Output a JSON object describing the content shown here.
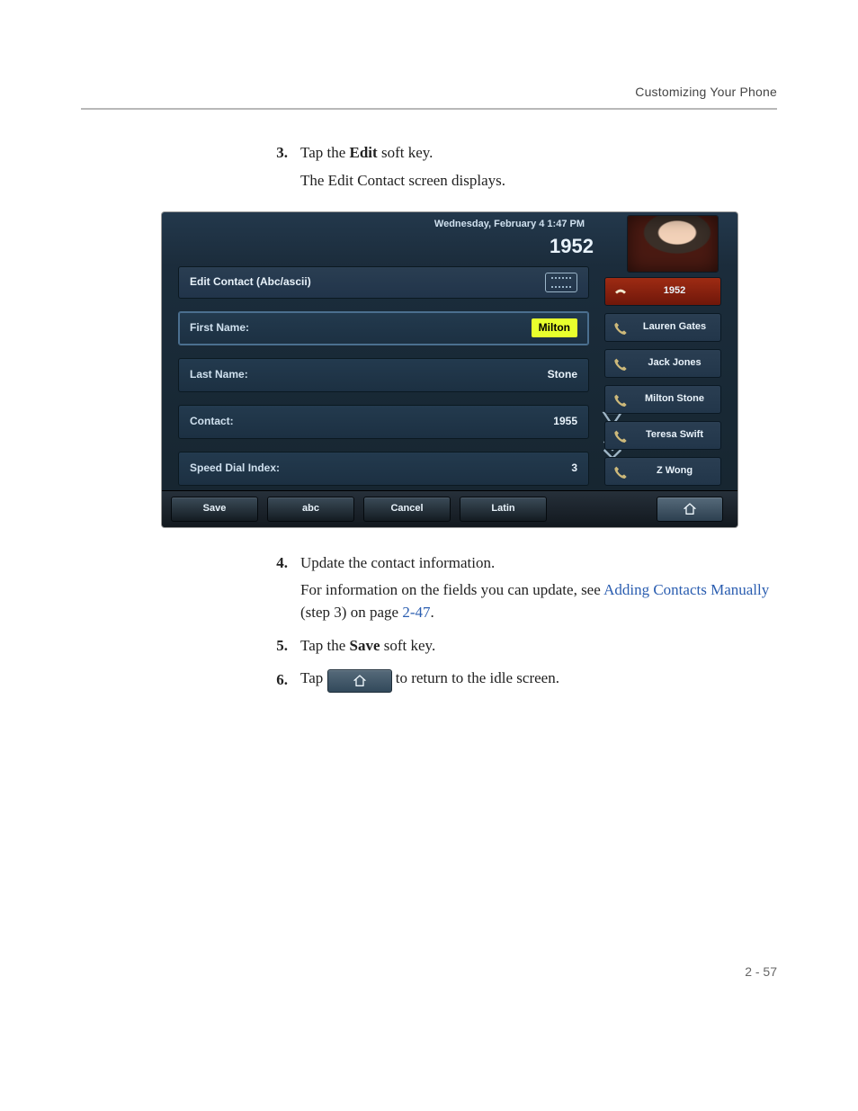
{
  "header": {
    "running_head": "Customizing Your Phone"
  },
  "steps": {
    "s3_num": "3.",
    "s3_text_a": "Tap the ",
    "s3_bold": "Edit",
    "s3_text_b": " soft key.",
    "s3_sub": "The Edit Contact screen displays.",
    "s4_num": "4.",
    "s4_text": "Update the contact information.",
    "s4_sub_a": "For information on the fields you can update, see ",
    "s4_link": "Adding Contacts Manually",
    "s4_sub_b": " (step 3) on page ",
    "s4_pageref": "2-47",
    "s4_sub_c": ".",
    "s5_num": "5.",
    "s5_text_a": "Tap the ",
    "s5_bold": "Save",
    "s5_text_b": " soft key.",
    "s6_num": "6.",
    "s6_text_a": "Tap ",
    "s6_text_b": " to return to the idle screen."
  },
  "footer": {
    "page_number": "2 - 57"
  },
  "screenshot": {
    "date": "Wednesday, February 4  1:47 PM",
    "extension": "1952",
    "panel_title": "Edit Contact (Abc/ascii)",
    "fields": {
      "first_name": {
        "label": "First Name:",
        "value": "Milton"
      },
      "last_name": {
        "label": "Last Name:",
        "value": "Stone"
      },
      "contact": {
        "label": "Contact:",
        "value": "1955"
      },
      "speed_dial": {
        "label": "Speed Dial Index:",
        "value": "3"
      }
    },
    "sidebar": {
      "items": [
        {
          "label": "1952",
          "icon": "handset-down-icon",
          "variant": "red"
        },
        {
          "label": "Lauren Gates",
          "icon": "handset-icon",
          "variant": "normal"
        },
        {
          "label": "Jack Jones",
          "icon": "handset-icon",
          "variant": "normal"
        },
        {
          "label": "Milton Stone",
          "icon": "handset-icon",
          "variant": "normal"
        },
        {
          "label": "Teresa Swift",
          "icon": "handset-icon",
          "variant": "normal"
        },
        {
          "label": "Z Wong",
          "icon": "handset-icon",
          "variant": "normal"
        }
      ]
    },
    "softkeys": {
      "save": "Save",
      "abc": "abc",
      "cancel": "Cancel",
      "latin": "Latin"
    }
  }
}
